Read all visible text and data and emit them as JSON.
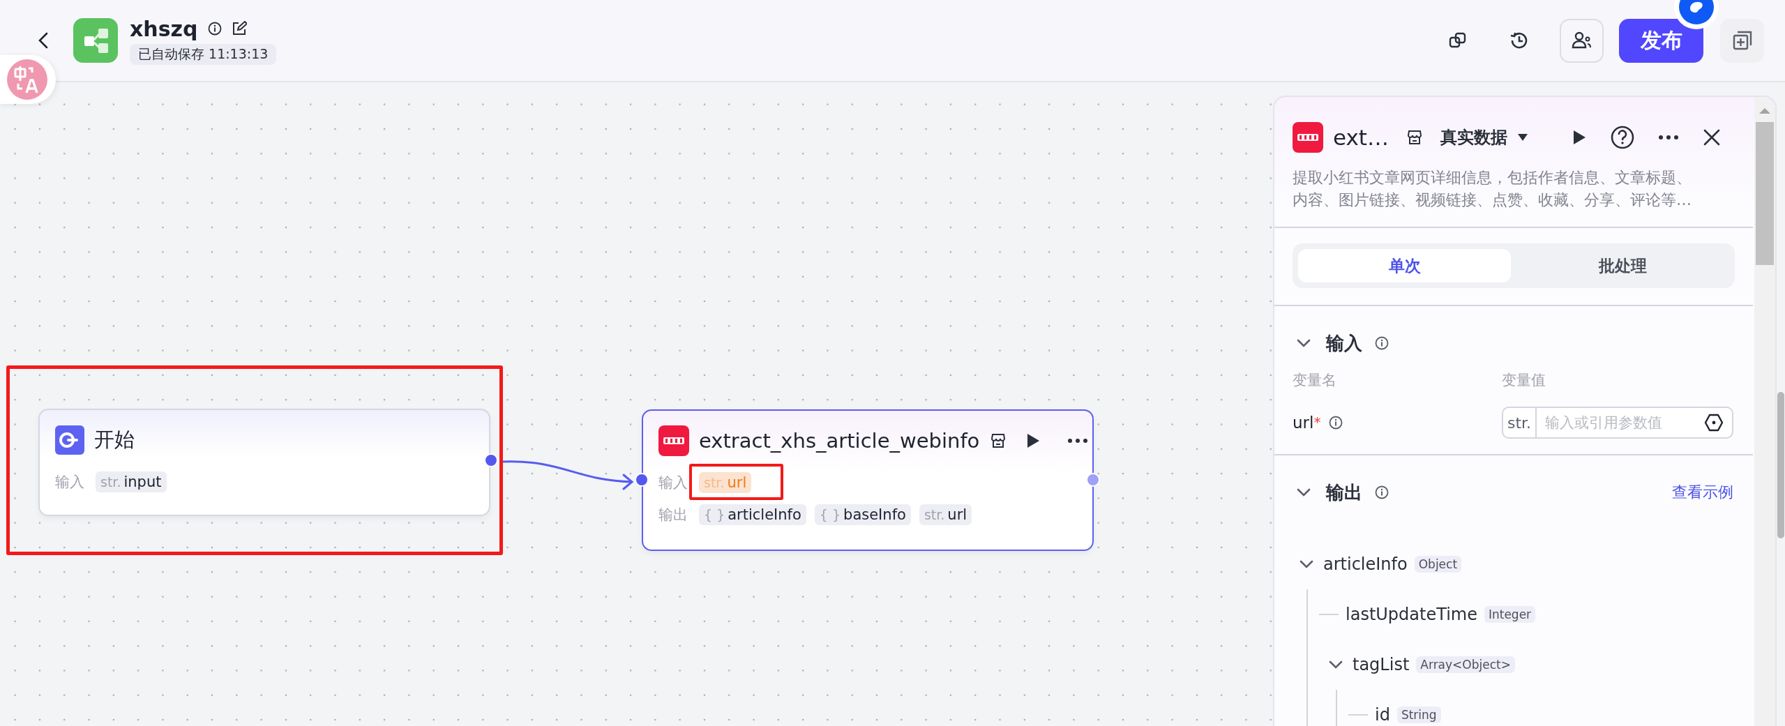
{
  "header": {
    "title": "xhszq",
    "save_status": "已自动保存 11:13:13",
    "publish_button": "发布"
  },
  "canvas": {
    "nodes": [
      {
        "kind": "start",
        "title": "开始",
        "selected": false,
        "highlighted": true,
        "rows": [
          {
            "label": "输入",
            "params": [
              {
                "type": "str.",
                "name": "input",
                "warning": false,
                "highlighted": false
              }
            ]
          }
        ]
      },
      {
        "kind": "plugin",
        "title": "extract_xhs_article_webinfo",
        "selected": true,
        "highlighted": false,
        "rows": [
          {
            "label": "输入",
            "params": [
              {
                "type": "str.",
                "name": "url",
                "warning": true,
                "highlighted": true
              }
            ]
          },
          {
            "label": "输出",
            "params": [
              {
                "type": "{ }",
                "name": "articleInfo",
                "warning": false,
                "highlighted": false
              },
              {
                "type": "{ }",
                "name": "baseInfo",
                "warning": false,
                "highlighted": false
              },
              {
                "type": "str.",
                "name": "url",
                "warning": false,
                "highlighted": false
              }
            ]
          }
        ]
      }
    ]
  },
  "panel": {
    "title": "ext…",
    "data_mode": "真实数据",
    "description": "提取小红书文章网页详细信息，包括作者信息、文章标题、内容、图片链接、视频链接、点赞、收藏、分享、评论等…",
    "tabs": [
      {
        "label": "单次",
        "selected": true
      },
      {
        "label": "批处理",
        "selected": false
      }
    ],
    "input_section": {
      "title": "输入",
      "expanded": true,
      "columns": [
        "变量名",
        "变量值"
      ],
      "params": [
        {
          "name": "url",
          "required_mark": "*",
          "type": "str.",
          "placeholder": "输入或引用参数值"
        }
      ]
    },
    "output_section": {
      "title": "输出",
      "expanded": true,
      "link": "查看示例",
      "tree": [
        {
          "name": "articleInfo",
          "type": "Object",
          "expanded": true,
          "children": [
            {
              "name": "lastUpdateTime",
              "type": "Integer"
            },
            {
              "name": "tagList",
              "type": "Array<Object>",
              "expanded": true,
              "children": [
                {
                  "name": "id",
                  "type": "String"
                }
              ]
            }
          ]
        }
      ]
    }
  }
}
